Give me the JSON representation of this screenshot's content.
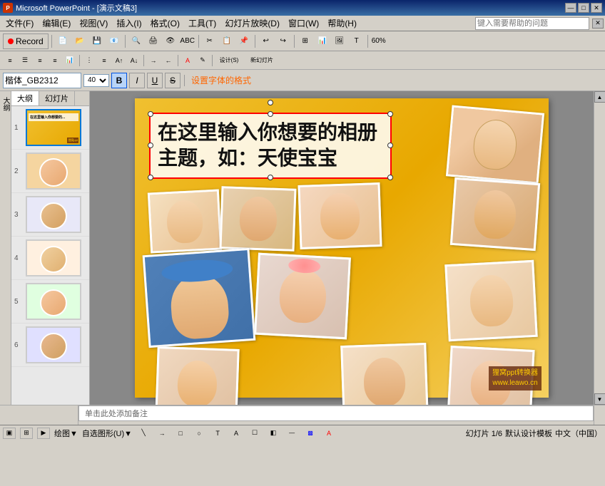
{
  "window": {
    "title": "Microsoft PowerPoint - [演示文稿3]",
    "icon": "PP"
  },
  "title_bar": {
    "title": "Microsoft PowerPoint - [演示文稿3]",
    "min_label": "—",
    "max_label": "□",
    "close_label": "✕"
  },
  "menu": {
    "items": [
      "文件(F)",
      "编辑(E)",
      "视图(V)",
      "插入(I)",
      "格式(O)",
      "工具(T)",
      "幻灯片放映(D)",
      "窗口(W)",
      "帮助(H)"
    ]
  },
  "help_search": {
    "placeholder": "键入需要帮助的问题"
  },
  "record_button": {
    "label": "Record"
  },
  "toolbar1": {
    "icons": [
      "new",
      "open",
      "save",
      "email",
      "search",
      "print",
      "preview",
      "spell",
      "cut",
      "copy",
      "paste",
      "undo",
      "redo",
      "insert",
      "table",
      "chart",
      "zoom"
    ]
  },
  "format_bar": {
    "font_name": "楷体_GB2312",
    "font_size": "40",
    "bold": true,
    "italic": false,
    "underline": false,
    "strikethrough": false,
    "hint_label": "设置字体的格式",
    "new_slide_label": "新幻灯片",
    "design_label": "设计(S)"
  },
  "slide_panel": {
    "tabs": [
      "大纲",
      "幻灯片"
    ],
    "active_tab": "大纲",
    "slides": [
      {
        "num": "1",
        "selected": true
      },
      {
        "num": "2"
      },
      {
        "num": "3"
      },
      {
        "num": "4"
      },
      {
        "num": "5"
      },
      {
        "num": "6"
      }
    ]
  },
  "canvas": {
    "slide_text": "在这里输入你想要的相册主题，如：天使宝宝",
    "watermark_line1": "狸窝ppt转换器",
    "watermark_line2": "www.leawo.cn"
  },
  "bottom": {
    "note_placeholder": "单击此处添加备注"
  },
  "status_bar": {
    "slide_info": "绘图▼",
    "auto_shapes": "自选图形(U)▼",
    "zoom": "60%"
  }
}
